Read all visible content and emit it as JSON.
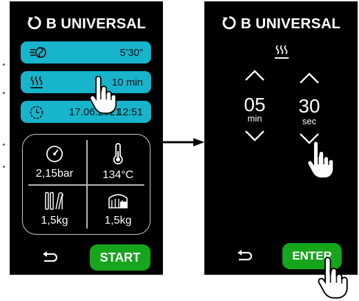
{
  "brand": "B UNIVERSAL",
  "left_screen": {
    "rows": [
      {
        "icon": "fan-speed-icon",
        "value": "5’30”"
      },
      {
        "icon": "steam-icon",
        "value": "10 min"
      },
      {
        "icon": "clock-icon",
        "date": "17.06.2021",
        "time": "12:51"
      }
    ],
    "stats": {
      "pressure": "2,15bar",
      "temperature": "134°C",
      "instruments_load": "1,5kg",
      "textile_load": "1,5kg"
    },
    "back_icon": "return-arrow-icon",
    "start_label": "START"
  },
  "right_screen": {
    "header_icon": "steam-icon",
    "minutes": {
      "value": "05",
      "unit": "min"
    },
    "seconds": {
      "value": "30",
      "unit": "sec"
    },
    "back_icon": "return-arrow-icon",
    "enter_label": "ENTER"
  },
  "colors": {
    "screen_bg": "#000000",
    "pill": "#17b4cc",
    "button_green": "#16a51c",
    "stats_border": "#cfcfcf"
  }
}
